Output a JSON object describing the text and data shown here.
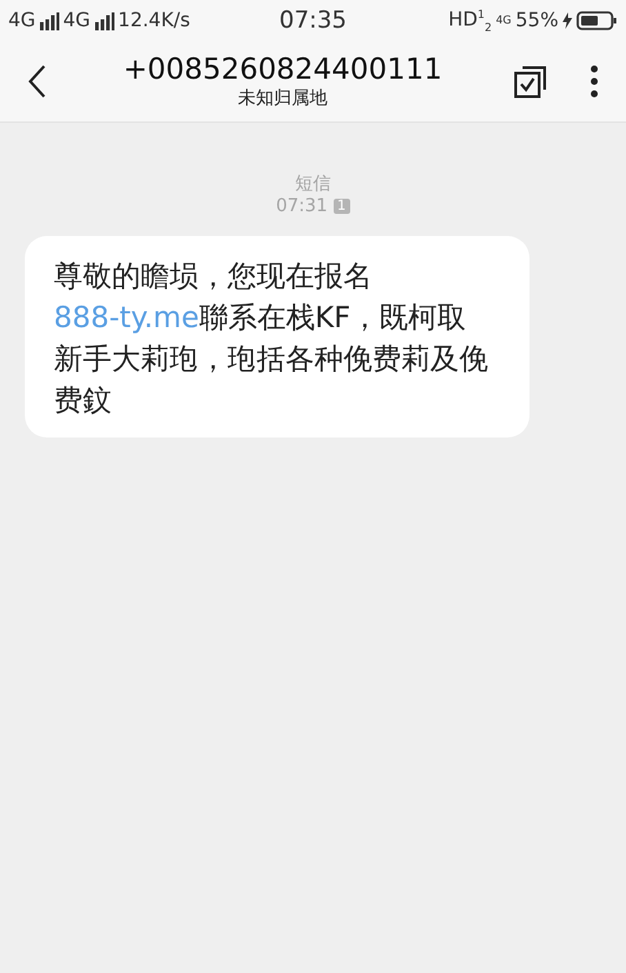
{
  "status_bar": {
    "network_1": "4G",
    "network_2": "4G",
    "speed": "12.4K/s",
    "time": "07:35",
    "hd": "HD$^{1}$$_{2}$",
    "network_3": "4G",
    "battery": "55%"
  },
  "header": {
    "title": "+0085260824400111",
    "subtitle": "未知归属地"
  },
  "thread": {
    "label": "短信",
    "time": "07:31",
    "sim": "1",
    "message": {
      "text_before": "尊敬的瞻埙，您现在报名",
      "link": "888-ty.me",
      "text_after": "聯系在栈KF，既柯取新手大莉玸，玸括各种俛费莉及俛费鈫"
    }
  }
}
